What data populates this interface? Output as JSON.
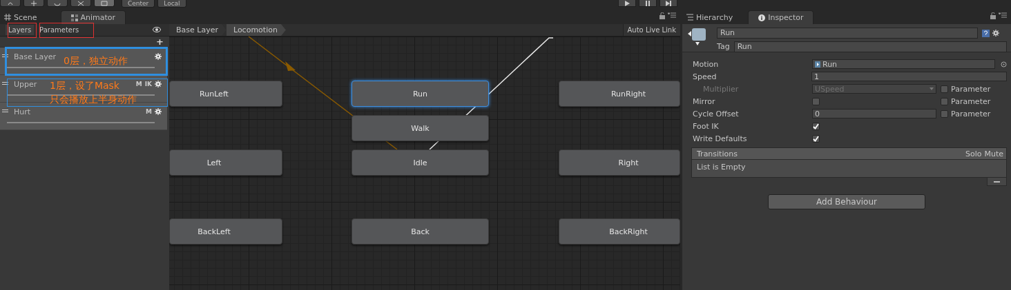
{
  "toolbar": {
    "pivot_buttons": [
      "Center",
      "Local"
    ]
  },
  "left_tabs": [
    {
      "label": "Scene",
      "selected": false
    },
    {
      "label": "Animator",
      "selected": true
    }
  ],
  "right_tabs": [
    {
      "label": "Hierarchy",
      "selected": false
    },
    {
      "label": "Inspector",
      "selected": true
    }
  ],
  "animator": {
    "panel_tabs": [
      {
        "label": "Layers",
        "selected": true
      },
      {
        "label": "Parameters",
        "selected": false
      }
    ],
    "add_button": "+",
    "layers": [
      {
        "name": "Base Layer"
      },
      {
        "name": "Upper",
        "badges": [
          "M",
          "IK"
        ]
      },
      {
        "name": "Hurt",
        "badges": [
          "M"
        ]
      }
    ],
    "annotations": [
      {
        "text": "0层，独立动作"
      },
      {
        "text": "1层，设了Mask"
      },
      {
        "text": "只会播放上半身动作"
      }
    ],
    "breadcrumbs": [
      "Base Layer",
      "Locomotion"
    ],
    "auto_live_link": "Auto Live Link",
    "states": [
      {
        "name": "RunLeft",
        "selected": false
      },
      {
        "name": "Run",
        "selected": true
      },
      {
        "name": "RunRight",
        "selected": false
      },
      {
        "name": "Walk",
        "selected": false
      },
      {
        "name": "Left",
        "selected": false
      },
      {
        "name": "Idle",
        "selected": false
      },
      {
        "name": "Right",
        "selected": false
      },
      {
        "name": "BackLeft",
        "selected": false
      },
      {
        "name": "Back",
        "selected": false
      },
      {
        "name": "BackRight",
        "selected": false
      }
    ]
  },
  "inspector": {
    "name": "Run",
    "tag_label": "Tag",
    "tag": "Run",
    "properties": [
      {
        "kind": "object",
        "label": "Motion",
        "value": "Run",
        "disabled": false
      },
      {
        "kind": "field",
        "label": "Speed",
        "value": "1",
        "disabled": false
      },
      {
        "kind": "dropdown",
        "label": "Multiplier",
        "value": "USpeed",
        "disabled": true,
        "parameter": {
          "label": "Parameter",
          "checked": false
        }
      },
      {
        "kind": "checkbox",
        "label": "Mirror",
        "checked": false,
        "disabled": false,
        "parameter": {
          "label": "Parameter",
          "checked": false
        }
      },
      {
        "kind": "field",
        "label": "Cycle Offset",
        "value": "0",
        "disabled": false,
        "parameter": {
          "label": "Parameter",
          "checked": false
        }
      },
      {
        "kind": "checkbox",
        "label": "Foot IK",
        "checked": true,
        "disabled": false
      },
      {
        "kind": "checkbox",
        "label": "Write Defaults",
        "checked": true,
        "disabled": false
      }
    ],
    "transitions": {
      "title": "Transitions",
      "columns": [
        "Solo",
        "Mute"
      ],
      "empty_text": "List is Empty"
    },
    "add_button": "Add Behaviour"
  }
}
